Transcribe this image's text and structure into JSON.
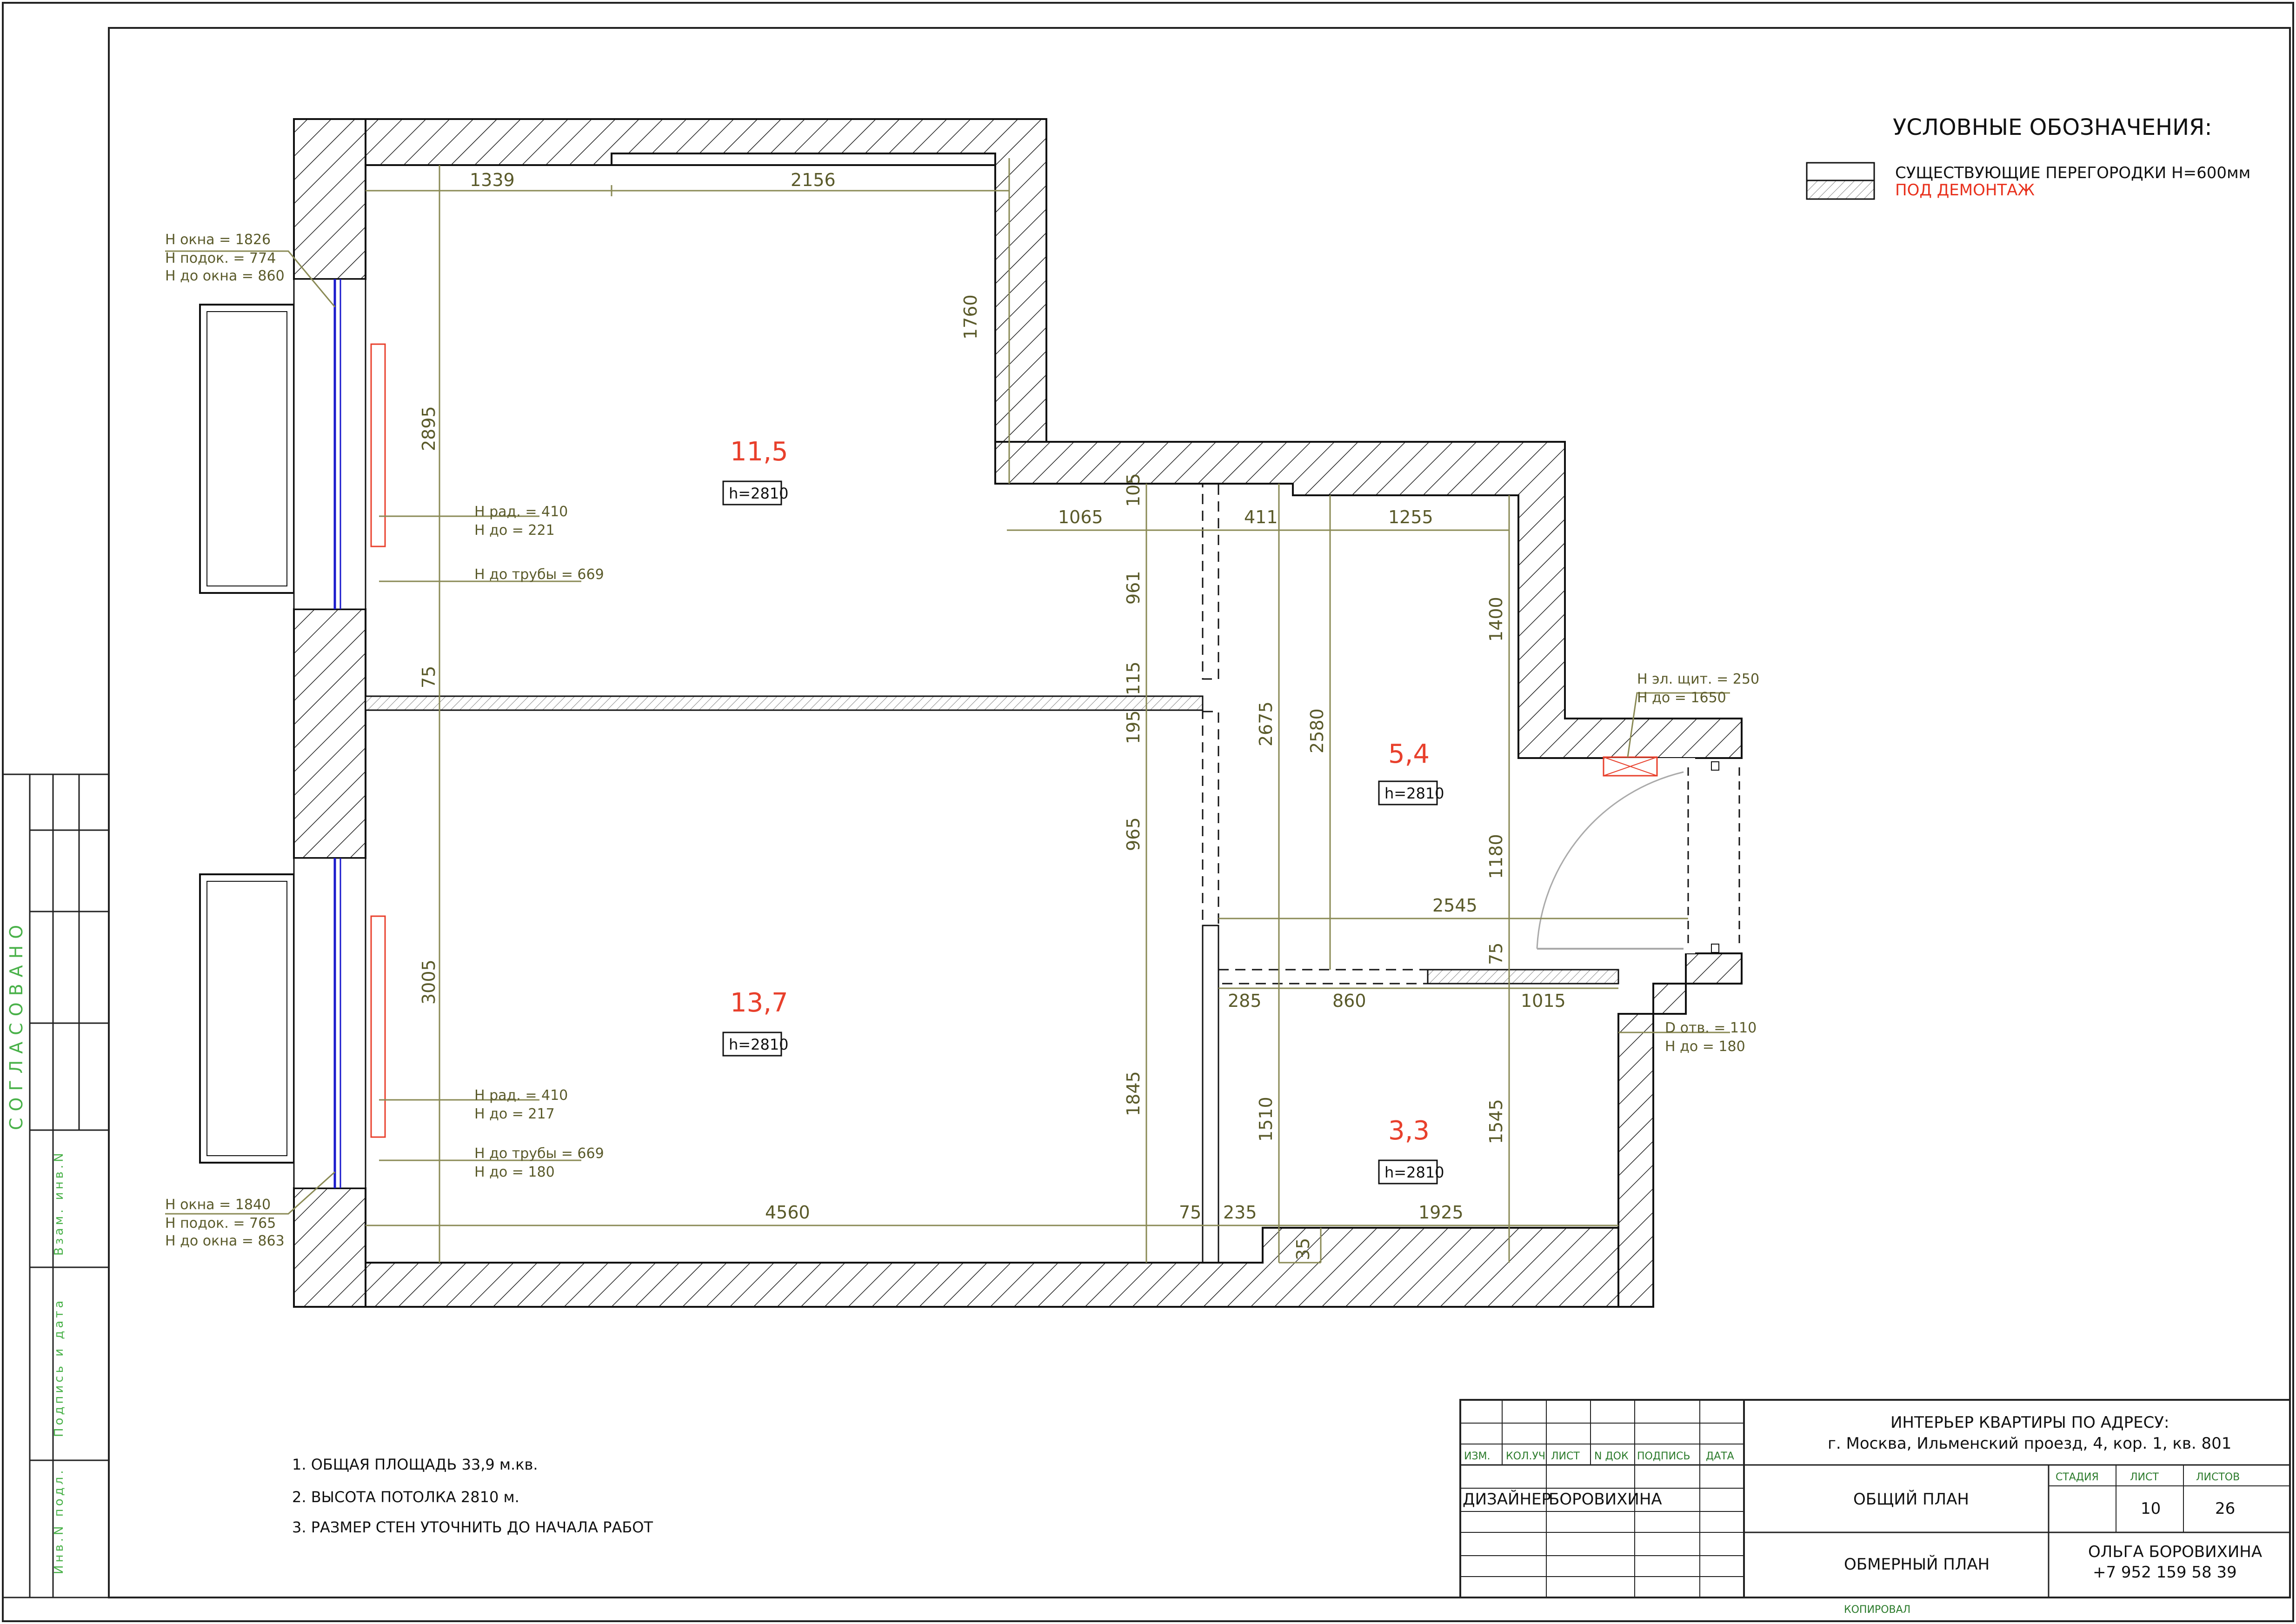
{
  "legend": {
    "title": "УСЛОВНЫЕ ОБОЗНАЧЕНИЯ:",
    "item1": "СУЩЕСТВУЮЩИЕ ПЕРЕГОРОДКИ H=600мм",
    "item2": "ПОД ДЕМОНТАЖ"
  },
  "rooms": [
    {
      "area": "11,5",
      "height": "h=2810"
    },
    {
      "area": "13,7",
      "height": "h=2810"
    },
    {
      "area": "5,4",
      "height": "h=2810"
    },
    {
      "area": "3,3",
      "height": "h=2810"
    }
  ],
  "dimensions": {
    "d1339": "1339",
    "d2156": "2156",
    "d1760": "1760",
    "d2895": "2895",
    "d105": "105",
    "d1065": "1065",
    "d411": "411",
    "d1255": "1255",
    "d961": "961",
    "d1400": "1400",
    "d75a": "75",
    "d115": "115",
    "d195": "195",
    "d2675": "2675",
    "d2580": "2580",
    "d965": "965",
    "d2545": "2545",
    "d1180": "1180",
    "d3005": "3005",
    "d75b": "75",
    "d285": "285",
    "d860": "860",
    "d1015": "1015",
    "d1845": "1845",
    "d1510": "1510",
    "d1545": "1545",
    "d4560": "4560",
    "d75c": "75",
    "d235": "235",
    "d1925": "1925",
    "d35": "35"
  },
  "notes_window_top": [
    "H окна = 1826",
    "H подок. = 774",
    "H до окна = 860"
  ],
  "notes_rad_top": [
    "H рад. = 410",
    "H до = 221"
  ],
  "notes_pipe_top": [
    "H до трубы = 669"
  ],
  "notes_rad_bottom": [
    "H рад. = 410",
    "H до = 217"
  ],
  "notes_pipe_bottom": [
    "H до трубы = 669",
    "H до = 180"
  ],
  "notes_window_bottom": [
    "H окна = 1840",
    "H подок. = 765",
    "H до окна = 863"
  ],
  "notes_panel": [
    "H эл. щит. = 250",
    "H до = 1650"
  ],
  "notes_hole": [
    "D отв. = 110",
    "H до = 180"
  ],
  "general_notes": [
    "1. ОБЩАЯ ПЛОЩАДЬ 33,9 м.кв.",
    "2. ВЫСОТА ПОТОЛКА 2810 м.",
    "3. РАЗМЕР СТЕН УТОЧНИТЬ ДО НАЧАЛА РАБОТ"
  ],
  "side_stamp": {
    "agreed": "СОГЛАСОВАНО",
    "replace": "Взам. инв.N",
    "sign": "Подпись и дата",
    "inv": "Инв.N подл."
  },
  "title_block": {
    "headers": [
      "ИЗМ.",
      "КОЛ.УЧ",
      "ЛИСТ",
      "N ДОК",
      "ПОДПИСЬ",
      "ДАТА"
    ],
    "role": "ДИЗАЙНЕР",
    "name": "БОРОВИХИНА",
    "project_line1": "ИНТЕРЬЕР КВАРТИРЫ ПО АДРЕСУ:",
    "project_line2": "г. Москва, Ильменский проезд, 4, кор. 1, кв. 801",
    "sheet_title": "ОБЩИЙ ПЛАН",
    "drawing_title": "ОБМЕРНЫЙ ПЛАН",
    "stage_label": "СТАДИЯ",
    "sheet_label": "ЛИСТ",
    "sheets_label": "ЛИСТОВ",
    "sheet_no": "10",
    "sheets_total": "26",
    "author": "ОЛЬГА БОРОВИХИНА",
    "phone": "+7 952 159 58 39",
    "copied": "КОПИРОВАЛ"
  }
}
